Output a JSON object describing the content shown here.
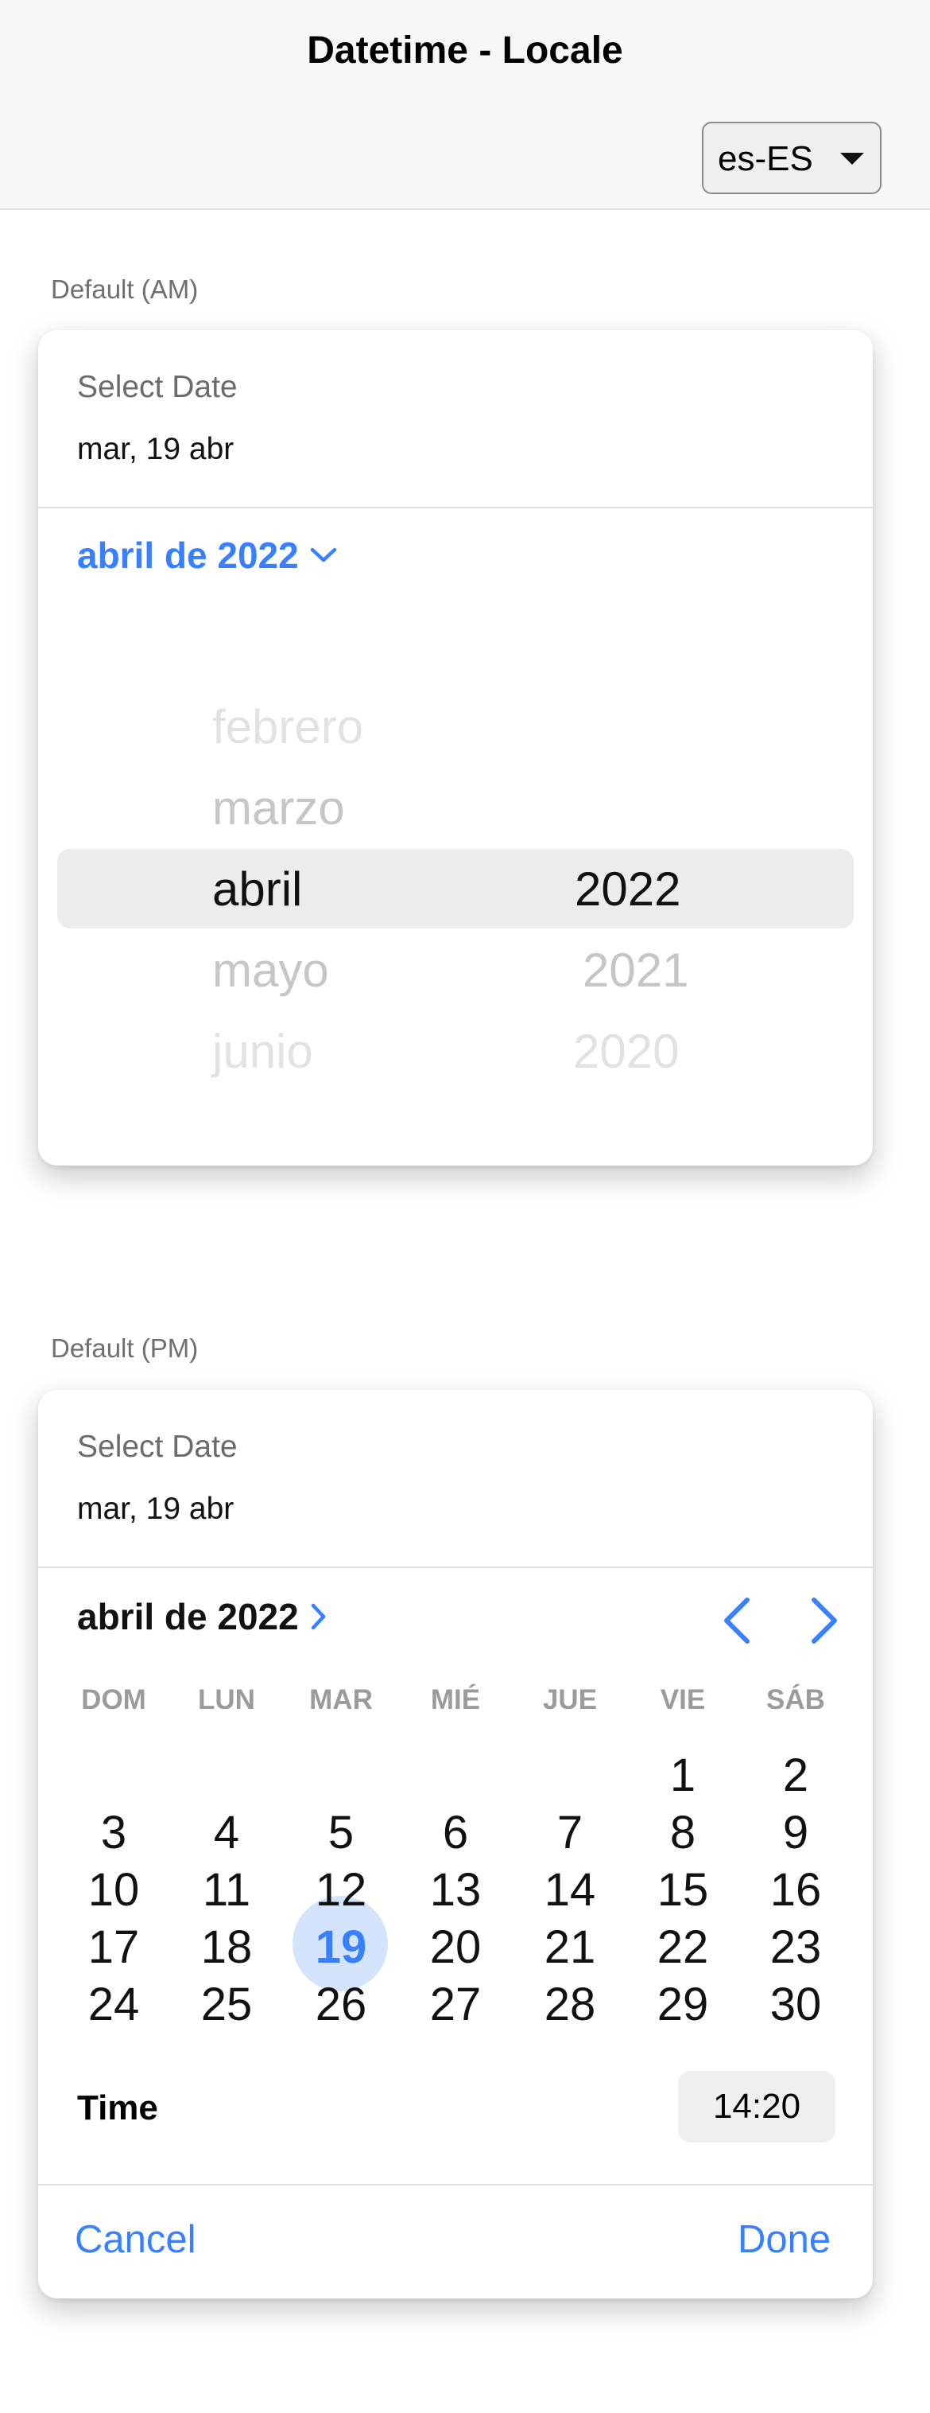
{
  "header": {
    "title": "Datetime - Locale",
    "locale_value": "es-ES"
  },
  "sections": {
    "am_label": "Default (AM)",
    "pm_label": "Default (PM)"
  },
  "picker_am": {
    "select_date_label": "Select Date",
    "selected_date": "mar, 19 abr",
    "month_year": "abril de 2022",
    "months": [
      "febrero",
      "marzo",
      "abril",
      "mayo",
      "junio"
    ],
    "years": [
      "2022",
      "2021",
      "2020"
    ],
    "selected_month": "abril",
    "selected_year": "2022"
  },
  "picker_pm": {
    "select_date_label": "Select Date",
    "selected_date": "mar, 19 abr",
    "month_year": "abril de 2022",
    "weekdays": [
      "DOM",
      "LUN",
      "MAR",
      "MIÉ",
      "JUE",
      "VIE",
      "SÁB"
    ],
    "days": [
      [
        "",
        "",
        "",
        "",
        "",
        "1",
        "2"
      ],
      [
        "3",
        "4",
        "5",
        "6",
        "7",
        "8",
        "9"
      ],
      [
        "10",
        "11",
        "12",
        "13",
        "14",
        "15",
        "16"
      ],
      [
        "17",
        "18",
        "19",
        "20",
        "21",
        "22",
        "23"
      ],
      [
        "24",
        "25",
        "26",
        "27",
        "28",
        "29",
        "30"
      ]
    ],
    "selected_day": "19",
    "time_label": "Time",
    "time_value": "14:20",
    "cancel_label": "Cancel",
    "done_label": "Done"
  },
  "colors": {
    "accent": "#3880ff",
    "selected_day_bg": "#d5e4fd"
  }
}
